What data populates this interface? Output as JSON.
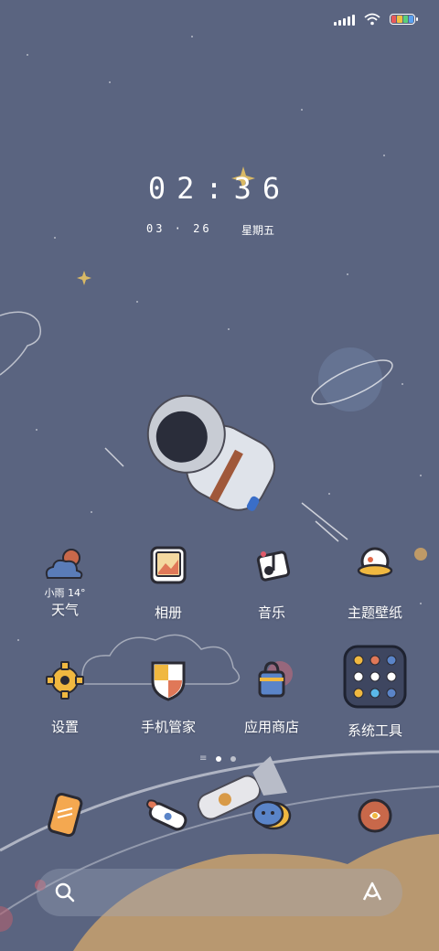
{
  "status": {
    "battery_colors": [
      "#e85a5a",
      "#f0c040",
      "#5ad07a",
      "#5aa0f0"
    ]
  },
  "clock": {
    "time": "02:36",
    "date": "03 · 26",
    "weekday": "星期五"
  },
  "weather_widget": {
    "text": "小雨 14°"
  },
  "apps_row1": [
    {
      "label": "天气",
      "icon": "weather-icon"
    },
    {
      "label": "相册",
      "icon": "gallery-icon"
    },
    {
      "label": "音乐",
      "icon": "music-icon"
    },
    {
      "label": "主题壁纸",
      "icon": "theme-icon"
    }
  ],
  "apps_row2": [
    {
      "label": "设置",
      "icon": "gear-icon"
    },
    {
      "label": "手机管家",
      "icon": "shield-icon"
    },
    {
      "label": "应用商店",
      "icon": "app-store-icon"
    },
    {
      "label": "系统工具",
      "icon": "folder-icon"
    }
  ],
  "dock": [
    {
      "icon": "phone-icon"
    },
    {
      "icon": "rocket-icon"
    },
    {
      "icon": "messages-icon"
    },
    {
      "icon": "browser-icon"
    }
  ],
  "colors": {
    "background": "#5a6480",
    "accent": "#f0b840"
  }
}
